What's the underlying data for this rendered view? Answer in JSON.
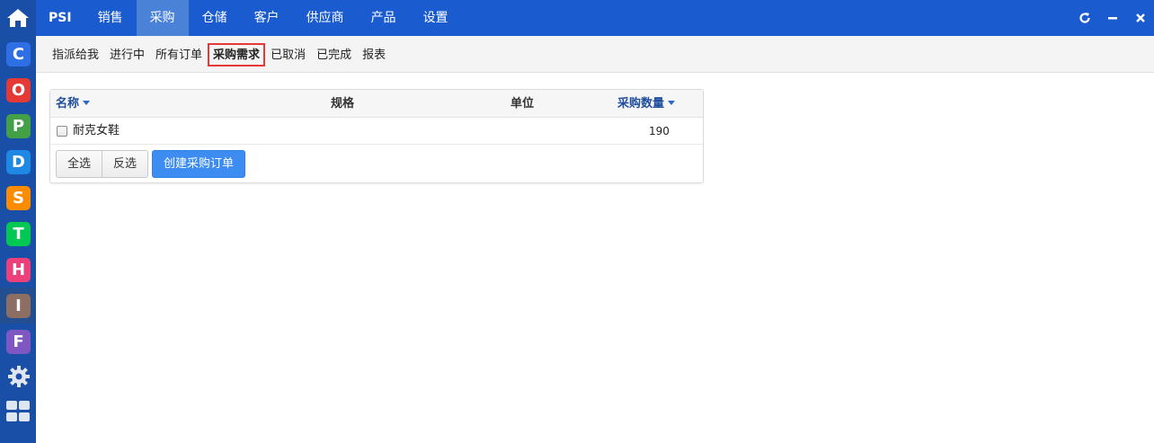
{
  "topbar": {
    "menu": [
      {
        "label": "PSI"
      },
      {
        "label": "销售"
      },
      {
        "label": "采购"
      },
      {
        "label": "仓储"
      },
      {
        "label": "客户"
      },
      {
        "label": "供应商"
      },
      {
        "label": "产品"
      },
      {
        "label": "设置"
      }
    ],
    "active_menu": "采购"
  },
  "rail": {
    "apps": [
      {
        "letter": "C",
        "color": "#2f6fe6"
      },
      {
        "letter": "O",
        "color": "#e53935"
      },
      {
        "letter": "P",
        "color": "#43a047"
      },
      {
        "letter": "D",
        "color": "#1e88e5"
      },
      {
        "letter": "S",
        "color": "#fb8c00"
      },
      {
        "letter": "T",
        "color": "#00c853"
      },
      {
        "letter": "H",
        "color": "#ec407a"
      },
      {
        "letter": "I",
        "color": "#8d6e63"
      },
      {
        "letter": "F",
        "color": "#7e57c2"
      }
    ]
  },
  "subnav": {
    "tabs": [
      {
        "label": "指派给我"
      },
      {
        "label": "进行中"
      },
      {
        "label": "所有订单"
      },
      {
        "label": "采购需求"
      },
      {
        "label": "已取消"
      },
      {
        "label": "已完成"
      },
      {
        "label": "报表"
      }
    ],
    "selected": "采购需求"
  },
  "table": {
    "columns": {
      "name": "名称",
      "spec": "规格",
      "unit": "单位",
      "qty": "采购数量"
    },
    "rows": [
      {
        "name": "耐克女鞋",
        "spec": "",
        "unit": "",
        "qty": "190"
      }
    ]
  },
  "actions": {
    "select_all": "全选",
    "invert": "反选",
    "create_order": "创建采购订单"
  }
}
